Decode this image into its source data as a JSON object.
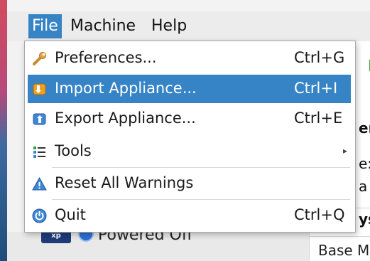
{
  "menubar": {
    "items": [
      {
        "label": "File",
        "active": true
      },
      {
        "label": "Machine",
        "active": false
      },
      {
        "label": "Help",
        "active": false
      }
    ]
  },
  "file_menu": {
    "items": [
      {
        "label": "Preferences...",
        "shortcut": "Ctrl+G",
        "icon": "wrench-icon",
        "highlighted": false
      },
      {
        "label": "Import Appliance...",
        "shortcut": "Ctrl+I",
        "icon": "import-appliance-icon",
        "highlighted": true
      },
      {
        "label": "Export Appliance...",
        "shortcut": "Ctrl+E",
        "icon": "export-appliance-icon",
        "highlighted": false
      },
      {
        "label": "Tools",
        "shortcut": "",
        "icon": "tools-list-icon",
        "highlighted": false,
        "submenu": true
      },
      {
        "label": "Reset All Warnings",
        "shortcut": "",
        "icon": "warning-icon",
        "highlighted": false
      },
      {
        "label": "Quit",
        "shortcut": "Ctrl+Q",
        "icon": "power-icon",
        "highlighted": false
      }
    ]
  },
  "background": {
    "vm_state": "Powered Off",
    "details_fragments": [
      "er",
      "e:",
      "a",
      "ys"
    ],
    "details_row": "Base M"
  },
  "colors": {
    "highlight": "#3684c6",
    "menubar_bg": "#ececec"
  }
}
